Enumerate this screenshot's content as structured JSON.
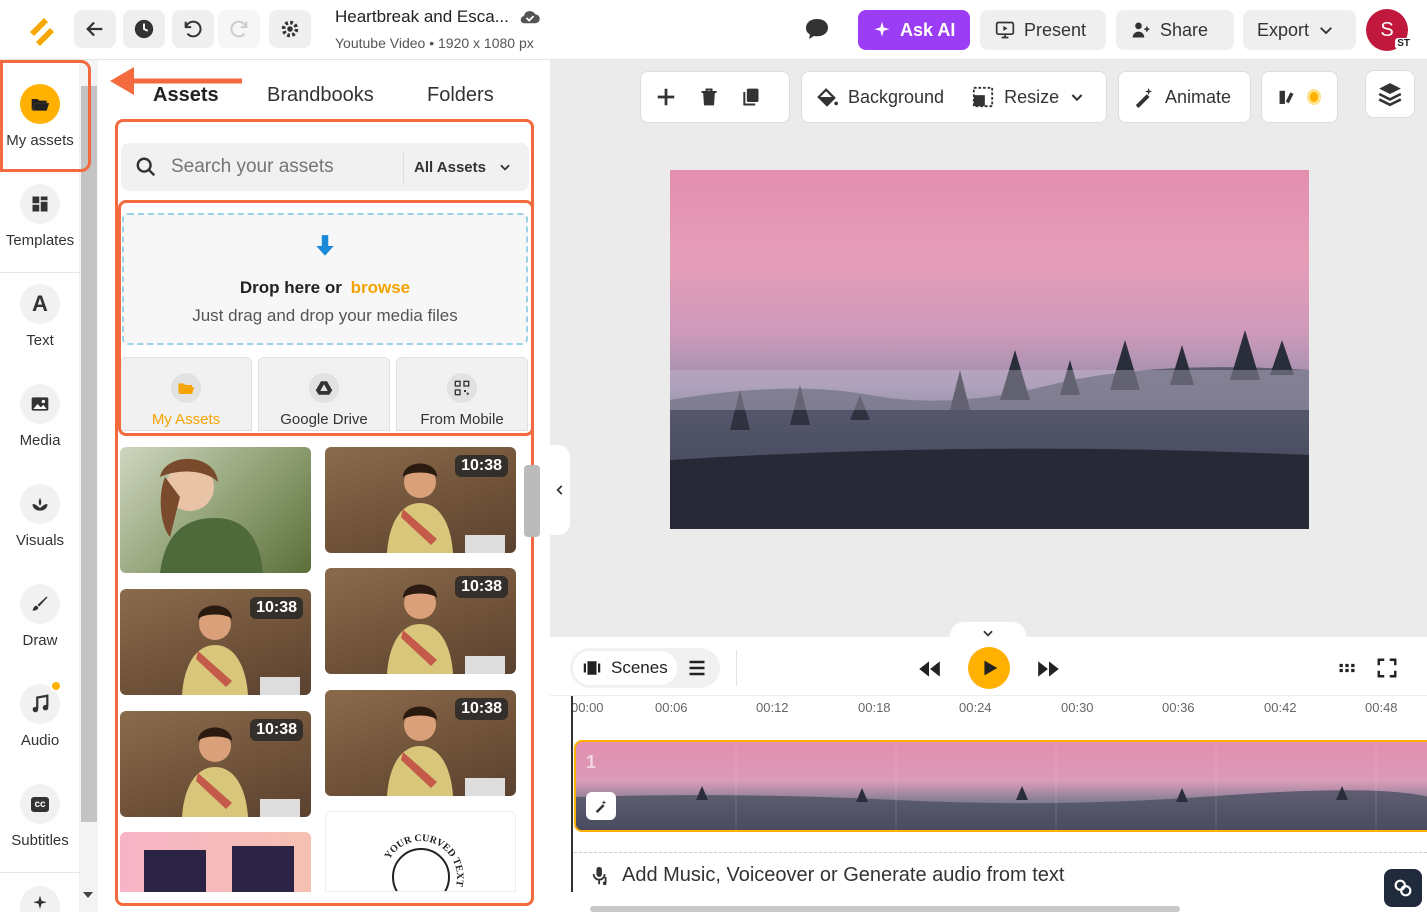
{
  "doc": {
    "title": "Heartbreak and Esca...",
    "subtitle": "Youtube Video • 1920 x 1080 px"
  },
  "header": {
    "ask_ai": "Ask AI",
    "present": "Present",
    "share": "Share",
    "export": "Export",
    "avatar_initial": "S",
    "avatar_badge": "ST"
  },
  "rail": {
    "items": [
      {
        "label": "My assets"
      },
      {
        "label": "Templates"
      },
      {
        "label": "Text"
      },
      {
        "label": "Media"
      },
      {
        "label": "Visuals"
      },
      {
        "label": "Draw"
      },
      {
        "label": "Audio"
      },
      {
        "label": "Subtitles"
      }
    ],
    "text_icon_glyph": "A",
    "subtitles_icon_glyph": "cc"
  },
  "panel": {
    "tabs": [
      "Assets",
      "Brandbooks",
      "Folders"
    ],
    "search_placeholder": "Search your assets",
    "filter": "All Assets",
    "drop_title": "Drop here or",
    "drop_browse": "browse",
    "drop_sub": "Just drag and drop your media files",
    "sources": [
      "My Assets",
      "Google Drive",
      "From Mobile"
    ],
    "durations": [
      "10:38",
      "10:38",
      "10:38",
      "10:38",
      "10:38"
    ],
    "curved_text": "YOUR CURVED TEXT"
  },
  "toolbar": {
    "background": "Background",
    "resize": "Resize",
    "animate": "Animate"
  },
  "timeline": {
    "scenes": "Scenes",
    "ticks": [
      "00:00",
      "00:06",
      "00:12",
      "00:18",
      "00:24",
      "00:30",
      "00:36",
      "00:42",
      "00:48"
    ],
    "scene_number": "1",
    "add_audio": "Add Music, Voiceover or Generate audio from text"
  },
  "colors": {
    "accent": "#ffb000",
    "highlight": "#f26a3d",
    "ask_ai": "#9b3df5",
    "selected_label": "#f5a300"
  }
}
